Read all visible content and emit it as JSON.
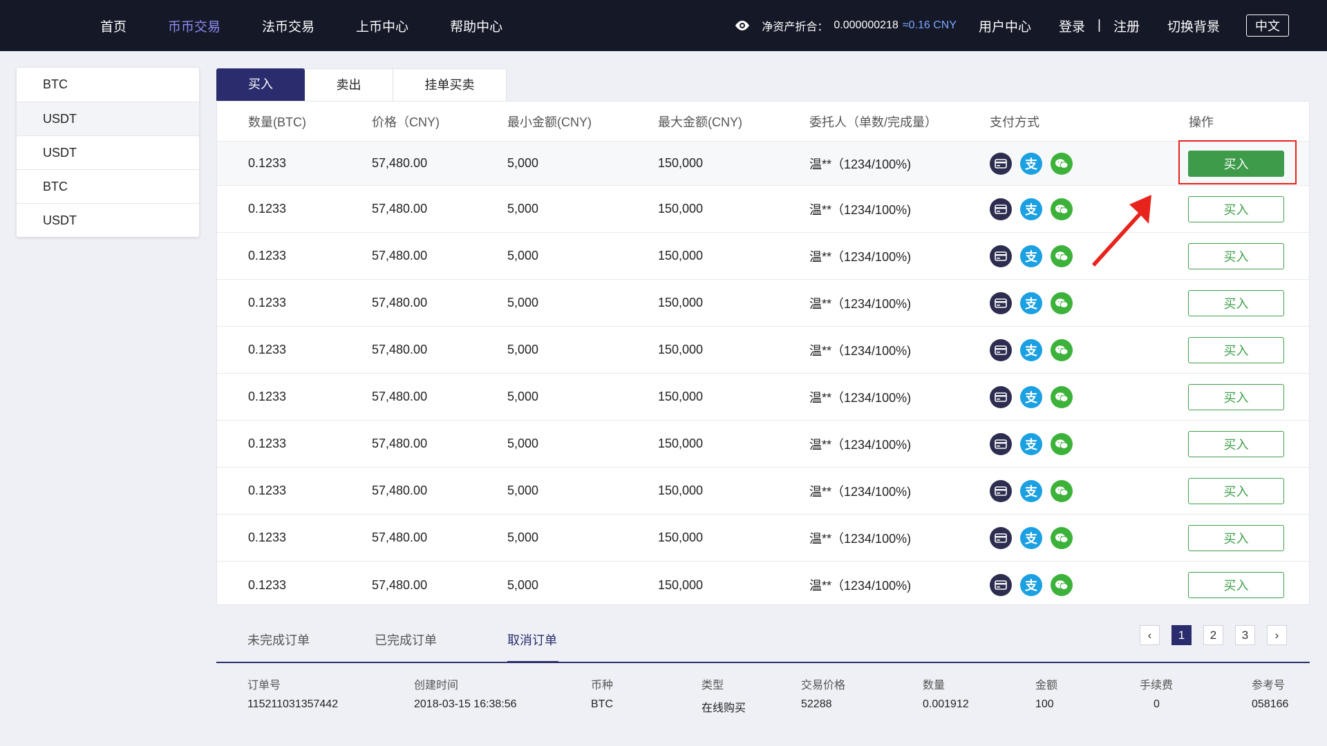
{
  "nav": {
    "items": [
      "首页",
      "币币交易",
      "法币交易",
      "上币中心",
      "帮助中心"
    ],
    "active_index": 1
  },
  "account": {
    "asset_label": "净资产折合：",
    "asset_value": "0.000000218",
    "asset_cny": "≈0.16 CNY",
    "user_center": "用户中心",
    "login": "登录",
    "separator": "|",
    "register": "注册",
    "switch_bg": "切换背景",
    "lang": "中文"
  },
  "sidebar": {
    "items": [
      "BTC",
      "USDT",
      "USDT",
      "BTC",
      "USDT"
    ],
    "active_index": 1
  },
  "tabs": [
    "买入",
    "卖出",
    "挂单买卖"
  ],
  "table": {
    "headers": [
      "数量(BTC)",
      "价格（CNY)",
      "最小金额(CNY)",
      "最大金额(CNY)",
      "委托人（单数/完成量）",
      "支付方式",
      "操作"
    ],
    "rows": [
      {
        "qty": "0.1233",
        "price": "57,480.00",
        "min": "5,000",
        "max": "150,000",
        "user": "温**（1234/100%)",
        "action": "买入"
      },
      {
        "qty": "0.1233",
        "price": "57,480.00",
        "min": "5,000",
        "max": "150,000",
        "user": "温**（1234/100%)",
        "action": "买入"
      },
      {
        "qty": "0.1233",
        "price": "57,480.00",
        "min": "5,000",
        "max": "150,000",
        "user": "温**（1234/100%)",
        "action": "买入"
      },
      {
        "qty": "0.1233",
        "price": "57,480.00",
        "min": "5,000",
        "max": "150,000",
        "user": "温**（1234/100%)",
        "action": "买入"
      },
      {
        "qty": "0.1233",
        "price": "57,480.00",
        "min": "5,000",
        "max": "150,000",
        "user": "温**（1234/100%)",
        "action": "买入"
      },
      {
        "qty": "0.1233",
        "price": "57,480.00",
        "min": "5,000",
        "max": "150,000",
        "user": "温**（1234/100%)",
        "action": "买入"
      },
      {
        "qty": "0.1233",
        "price": "57,480.00",
        "min": "5,000",
        "max": "150,000",
        "user": "温**（1234/100%)",
        "action": "买入"
      },
      {
        "qty": "0.1233",
        "price": "57,480.00",
        "min": "5,000",
        "max": "150,000",
        "user": "温**（1234/100%)",
        "action": "买入"
      },
      {
        "qty": "0.1233",
        "price": "57,480.00",
        "min": "5,000",
        "max": "150,000",
        "user": "温**（1234/100%)",
        "action": "买入"
      },
      {
        "qty": "0.1233",
        "price": "57,480.00",
        "min": "5,000",
        "max": "150,000",
        "user": "温**（1234/100%)",
        "action": "买入"
      }
    ],
    "payment_icons": [
      "bank-card-icon",
      "alipay-icon",
      "wechat-icon"
    ],
    "alipay_glyph": "支"
  },
  "order_tabs": {
    "items": [
      "未完成订单",
      "已完成订单",
      "取消订单"
    ],
    "active_index": 2
  },
  "pagination": {
    "pages": [
      "1",
      "2",
      "3"
    ],
    "active_index": 0,
    "prev": "‹",
    "next": "›"
  },
  "orders": {
    "headers": [
      "订单号",
      "创建时间",
      "币种",
      "类型",
      "交易价格",
      "数量",
      "金额",
      "手续费",
      "参考号"
    ],
    "row": [
      "115211031357442",
      "2018-03-15 16:38:56",
      "BTC",
      "在线购买",
      "52288",
      "0.001912",
      "100",
      "0",
      "058166"
    ]
  },
  "colors": {
    "nav_bg": "#141827",
    "accent": "#2b2c6e",
    "buy_green": "#3e9b49",
    "annotation_red": "#e8231b"
  }
}
